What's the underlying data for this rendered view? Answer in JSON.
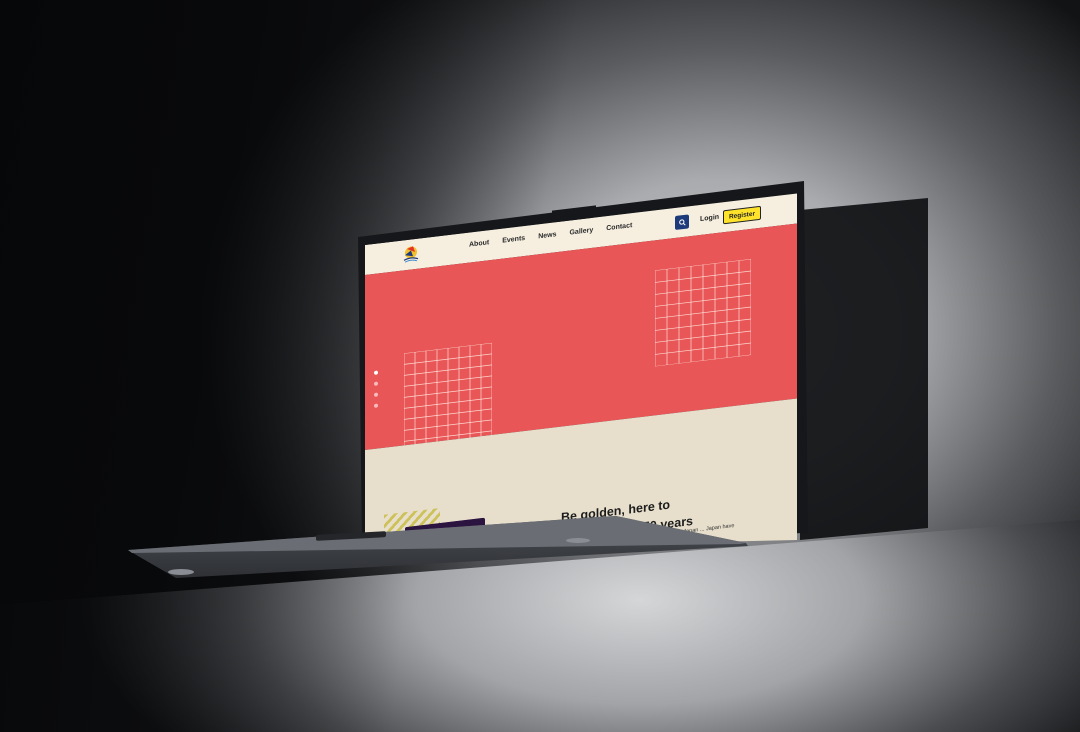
{
  "site": {
    "nav": [
      "About",
      "Events",
      "News",
      "Gallery",
      "Contact"
    ],
    "login_label": "Login",
    "register_label": "Register",
    "headline_line1": "Be golden, here to",
    "headline_line2": "start the next 50 years",
    "body_copy": "to the 50th Year of ASEAN-Japan ... Japan have built a ... Pacific region.",
    "icons": [
      "logo-icon",
      "search-icon"
    ]
  },
  "colors": {
    "hero_red": "#e95657",
    "header_cream": "#f6efe0",
    "section_beige": "#e7dfcc",
    "register_yellow": "#ffe22a",
    "search_navy": "#1d3a7a"
  },
  "hero_slides": 4,
  "hero_active_slide": 1
}
